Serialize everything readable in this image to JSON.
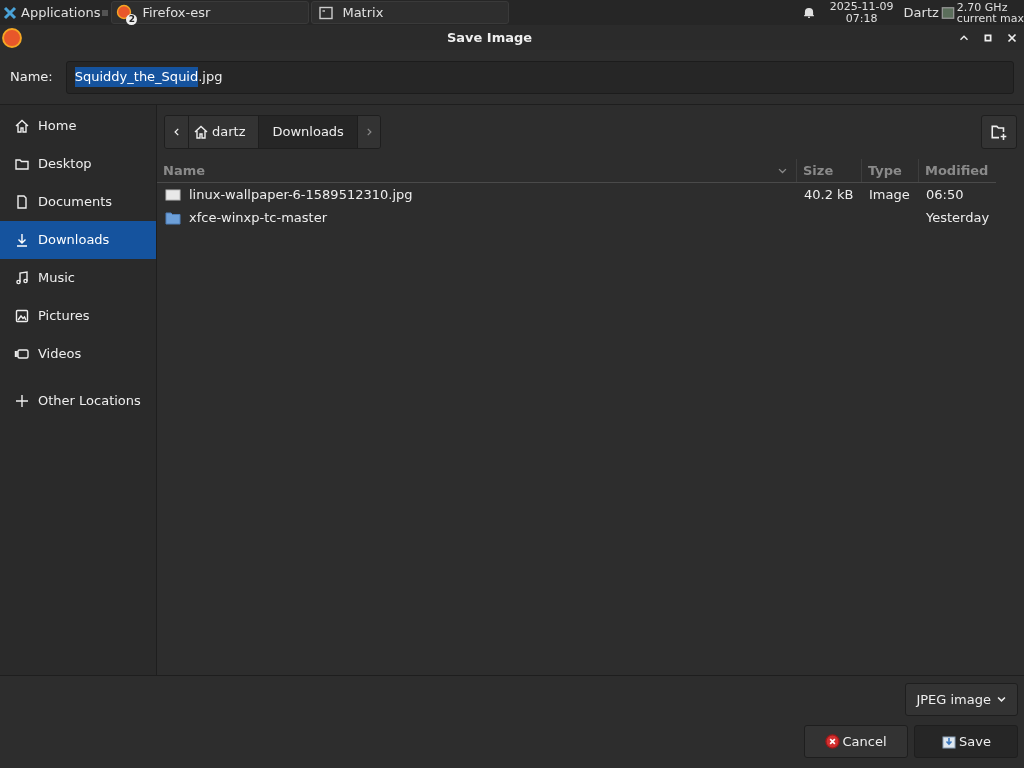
{
  "panel": {
    "apps_label": "Applications",
    "tasks": [
      {
        "label": "Firefox-esr",
        "badge": "2",
        "kind": "browser",
        "selected": false
      },
      {
        "label": "Matrix",
        "kind": "terminal",
        "selected": false
      }
    ],
    "date": "2025-11-09",
    "time": "07:18",
    "user": "Dartz",
    "cpu_line1": "2.70 GHz",
    "cpu_line2": "current max"
  },
  "window": {
    "title": "Save Image"
  },
  "name_field": {
    "label": "Name:",
    "selected_part": "Squiddy_the_Squid",
    "rest": ".jpg"
  },
  "sidebar": {
    "items": [
      {
        "label": "Home",
        "kind": "home",
        "selected": false
      },
      {
        "label": "Desktop",
        "kind": "folder",
        "selected": false
      },
      {
        "label": "Documents",
        "kind": "document",
        "selected": false
      },
      {
        "label": "Downloads",
        "kind": "download",
        "selected": true
      },
      {
        "label": "Music",
        "kind": "music",
        "selected": false
      },
      {
        "label": "Pictures",
        "kind": "picture",
        "selected": false
      },
      {
        "label": "Videos",
        "kind": "video",
        "selected": false
      },
      {
        "label": "Other Locations",
        "kind": "plus",
        "selected": false
      }
    ]
  },
  "path_bar": [
    {
      "label": "dartz",
      "kind": "home",
      "selected": false
    },
    {
      "label": "Downloads",
      "kind": "folder",
      "selected": true
    }
  ],
  "table": {
    "columns": [
      "Name",
      "Size",
      "Type",
      "Modified"
    ],
    "rows": [
      {
        "kind": "image",
        "name": "linux-wallpaper-6-1589512310.jpg",
        "size": "40.2 kB",
        "type": "Image",
        "modified": "06:50"
      },
      {
        "kind": "folder",
        "name": "xfce-winxp-tc-master",
        "size": "",
        "type": "",
        "modified": "Yesterday"
      }
    ]
  },
  "filter": {
    "value": "JPEG image"
  },
  "buttons": [
    {
      "label": "Cancel",
      "kind": "cancel"
    },
    {
      "label": "Save",
      "kind": "save"
    }
  ]
}
